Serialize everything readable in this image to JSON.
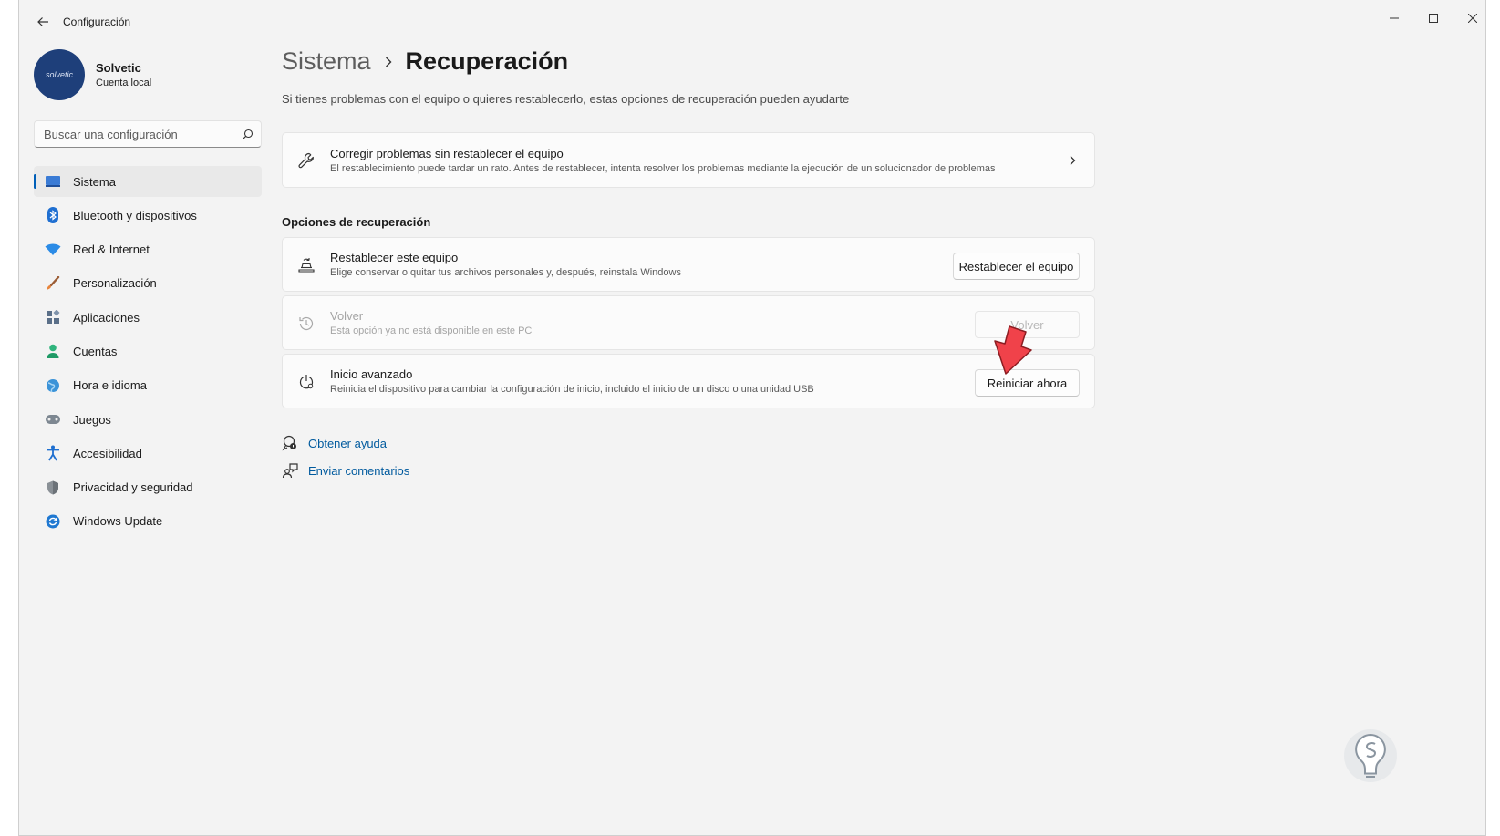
{
  "window": {
    "title": "Configuración"
  },
  "profile": {
    "name": "Solvetic",
    "account_type": "Cuenta local",
    "avatar_text": "solvetic"
  },
  "search": {
    "placeholder": "Buscar una configuración"
  },
  "sidebar": {
    "items": [
      {
        "label": "Sistema",
        "icon": "system-icon",
        "active": true
      },
      {
        "label": "Bluetooth y dispositivos",
        "icon": "bluetooth-icon"
      },
      {
        "label": "Red & Internet",
        "icon": "wifi-icon"
      },
      {
        "label": "Personalización",
        "icon": "brush-icon"
      },
      {
        "label": "Aplicaciones",
        "icon": "apps-icon"
      },
      {
        "label": "Cuentas",
        "icon": "person-icon"
      },
      {
        "label": "Hora e idioma",
        "icon": "globe-icon"
      },
      {
        "label": "Juegos",
        "icon": "gamepad-icon"
      },
      {
        "label": "Accesibilidad",
        "icon": "accessibility-icon"
      },
      {
        "label": "Privacidad y seguridad",
        "icon": "shield-icon"
      },
      {
        "label": "Windows Update",
        "icon": "update-icon"
      }
    ]
  },
  "main": {
    "breadcrumb": {
      "parent": "Sistema",
      "current": "Recuperación"
    },
    "subtitle": "Si tienes problemas con el equipo o quieres restablecerlo, estas opciones de recuperación pueden ayudarte",
    "fix_card": {
      "title": "Corregir problemas sin restablecer el equipo",
      "description": "El restablecimiento puede tardar un rato. Antes de restablecer, intenta resolver los problemas mediante la ejecución de un solucionador de problemas"
    },
    "section_title": "Opciones de recuperación",
    "options": [
      {
        "title": "Restablecer este equipo",
        "description": "Elige conservar o quitar tus archivos personales y, después, reinstala Windows",
        "button": "Restablecer el equipo",
        "enabled": true
      },
      {
        "title": "Volver",
        "description": "Esta opción ya no está disponible en este PC",
        "button": "Volver",
        "enabled": false
      },
      {
        "title": "Inicio avanzado",
        "description": "Reinicia el dispositivo para cambiar la configuración de inicio, incluido el inicio de un disco o una unidad USB",
        "button": "Reiniciar ahora",
        "enabled": true
      }
    ],
    "links": [
      {
        "label": "Obtener ayuda",
        "icon": "help-icon"
      },
      {
        "label": "Enviar comentarios",
        "icon": "feedback-icon"
      }
    ]
  },
  "colors": {
    "accent": "#005fb8",
    "link": "#005a9e",
    "annotation_arrow": "#f0424a",
    "avatar_bg": "#1e3f7a"
  }
}
